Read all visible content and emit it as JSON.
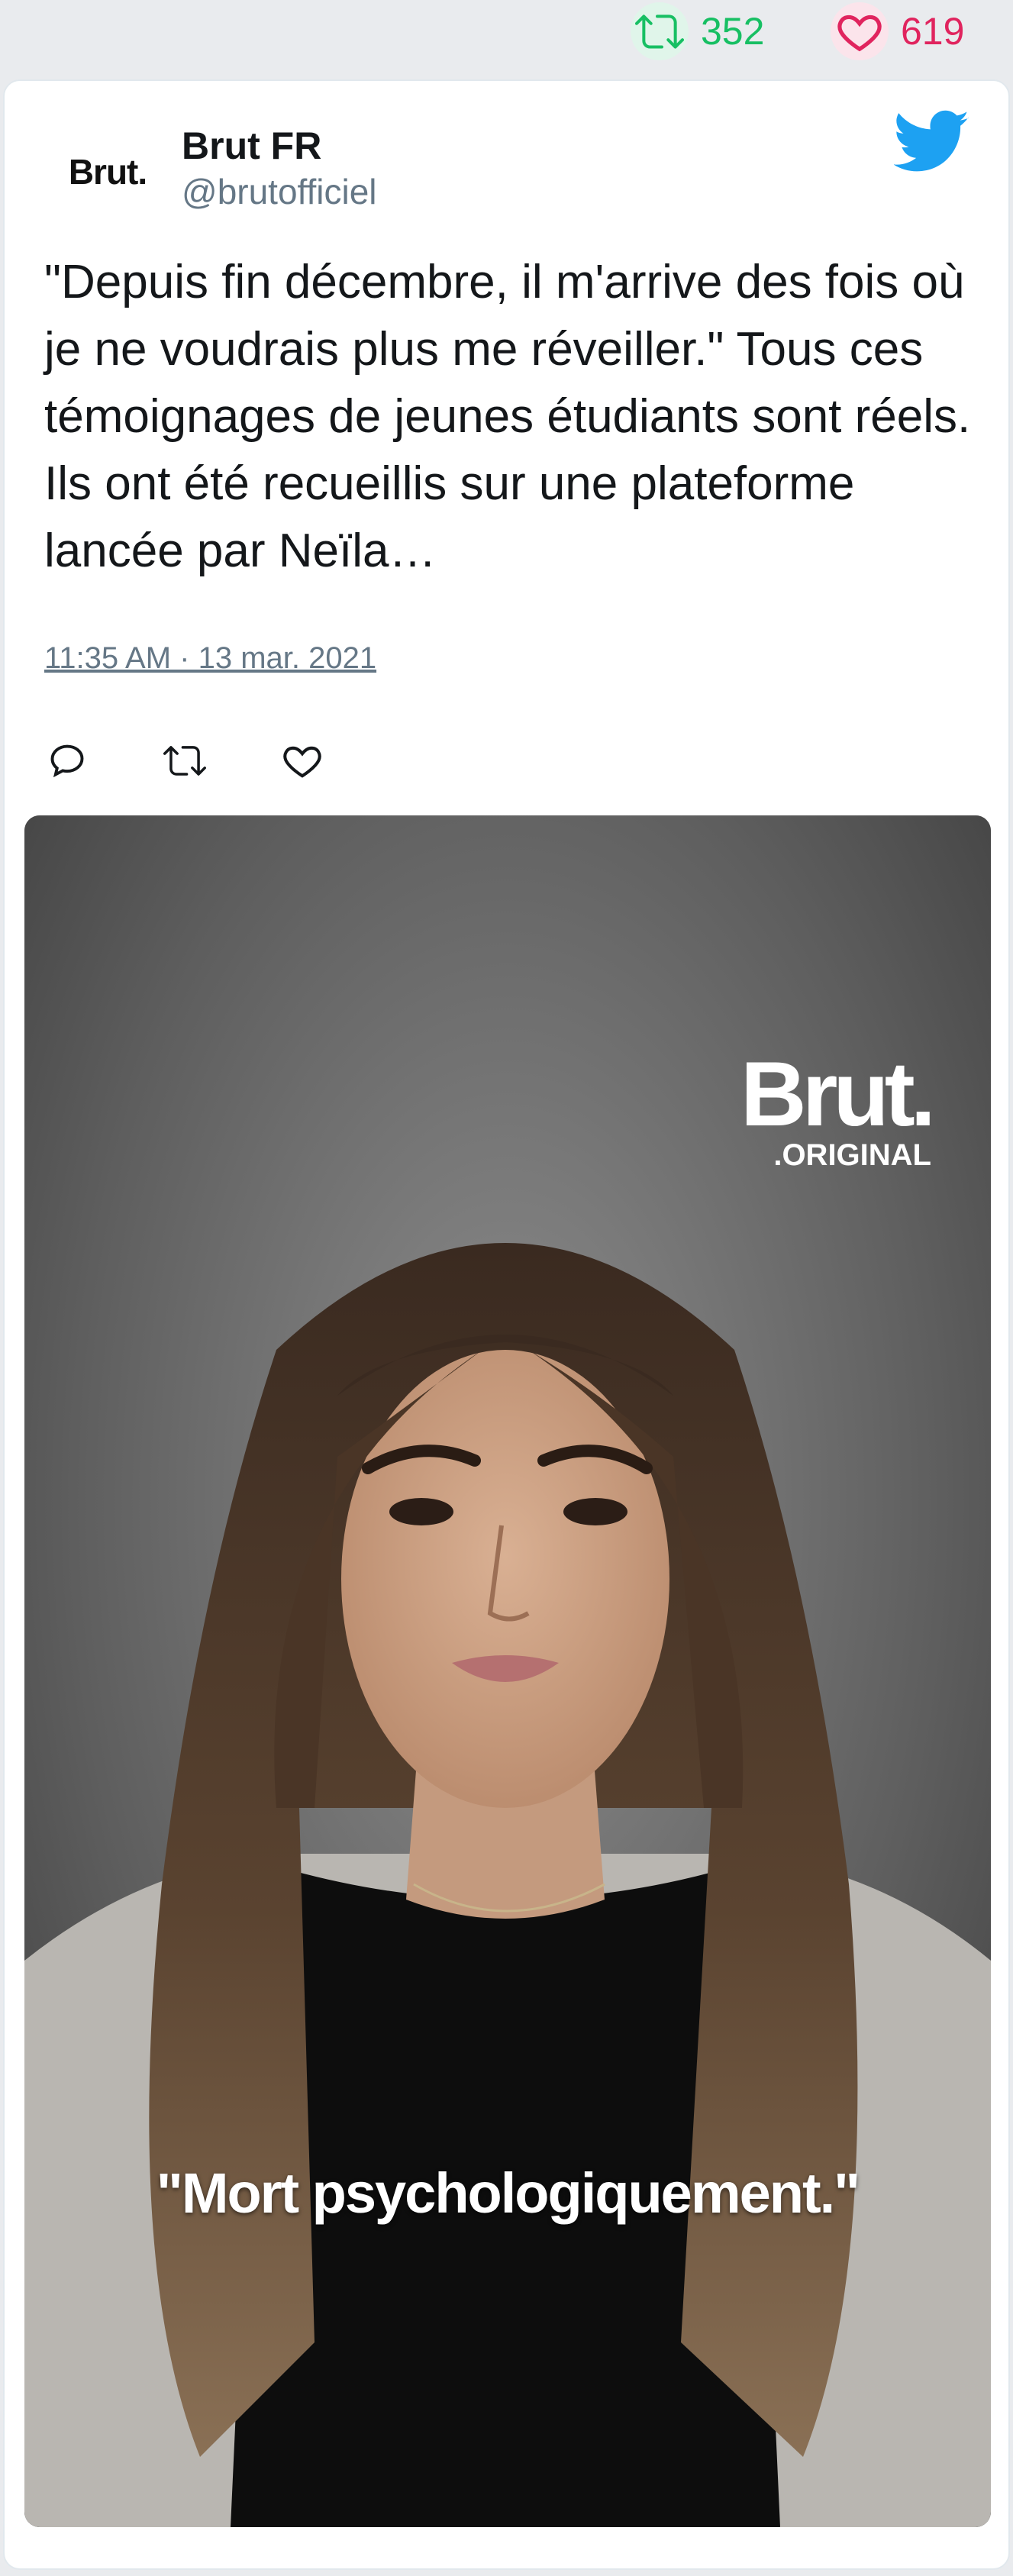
{
  "stats": {
    "retweets": "352",
    "likes": "619"
  },
  "author": {
    "avatar_text": "Brut.",
    "name": "Brut FR",
    "handle": "@brutofficiel"
  },
  "tweet": {
    "text": "\"Depuis fin décembre, il m'arrive des fois où je ne voudrais plus me réveiller.\" Tous ces témoignages de jeunes étudiants sont réels. Ils ont été recueillis sur une plateforme lancée par Neïla…",
    "timestamp": "11:35 AM · 13 mar. 2021"
  },
  "media": {
    "brand_name": "Brut.",
    "brand_sub": ".ORIGINAL",
    "caption": "\"Mort psychologiquement.\""
  },
  "colors": {
    "retweet": "#17bf63",
    "like": "#e0245e",
    "twitter_blue": "#1da1f2",
    "muted": "#657786"
  },
  "icons": [
    "retweet-icon",
    "heart-icon",
    "twitter-bird-icon",
    "reply-icon"
  ]
}
